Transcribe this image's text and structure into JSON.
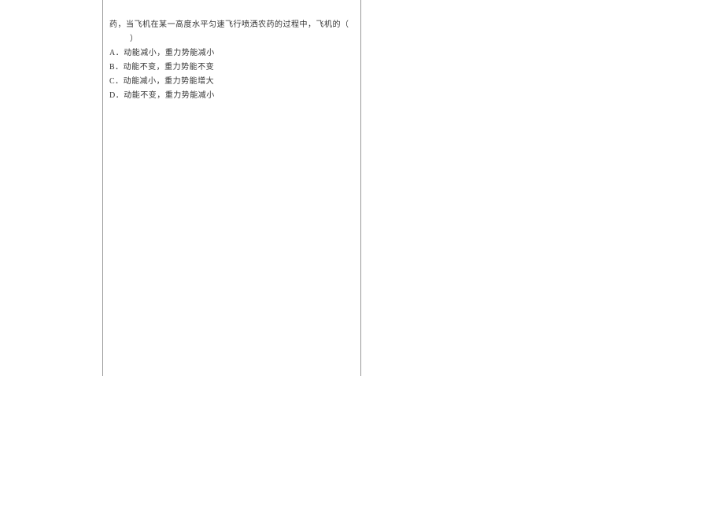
{
  "question": {
    "stem": "药，当飞机在某一高度水平匀速飞行喷洒农药的过程中，飞机的（",
    "stem_end": "）",
    "options": [
      {
        "label": "A．",
        "text": "动能减小，重力势能减小"
      },
      {
        "label": "B．",
        "text": "动能不变，重力势能不变"
      },
      {
        "label": "C．",
        "text": "动能减小，重力势能增大"
      },
      {
        "label": "D．",
        "text": "动能不变，重力势能减小"
      }
    ]
  }
}
